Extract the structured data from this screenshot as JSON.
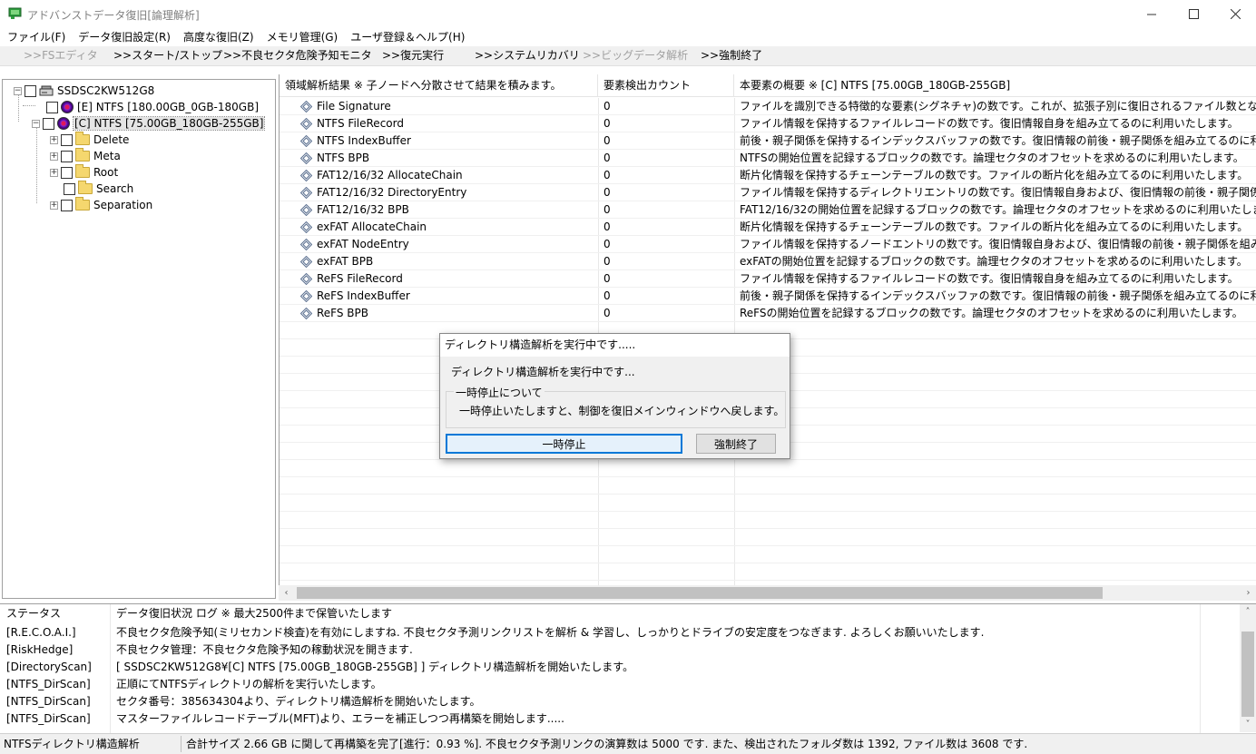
{
  "window": {
    "title": "アドバンストデータ復旧[論理解析]",
    "minimize": "—",
    "maximize": "☐",
    "close": "✕"
  },
  "menu": [
    "ファイル(F)",
    "データ復旧設定(R)",
    "高度な復旧(Z)",
    "メモリ管理(G)",
    "ユーザ登録＆ヘルプ(H)"
  ],
  "toolbar": [
    {
      "label": ">>FSエディタ",
      "enabled": false
    },
    {
      "label": ">>スタート/ストップ",
      "enabled": true
    },
    {
      "label": ">>不良セクタ危険予知モニタ",
      "enabled": true
    },
    {
      "label": ">>復元実行",
      "enabled": true
    },
    {
      "label": ">>システムリカバリ",
      "enabled": true
    },
    {
      "label": ">>ビッグデータ解析",
      "enabled": false
    },
    {
      "label": ">>強制終了",
      "enabled": true
    }
  ],
  "tree": {
    "disk": "SSDSC2KW512G8",
    "volumes": [
      {
        "label": "[E] NTFS [180.00GB_0GB-180GB]"
      },
      {
        "label": "[C] NTFS [75.00GB_180GB-255GB]"
      }
    ],
    "folders": [
      "Delete",
      "Meta",
      "Root",
      "Search",
      "Separation"
    ]
  },
  "list": {
    "headers": {
      "name": "領域解析結果 ※ 子ノードへ分散させて結果を積みます。",
      "count": "要素検出カウント",
      "desc": "本要素の概要 ※ [C] NTFS [75.00GB_180GB-255GB]"
    },
    "rows": [
      {
        "name": "File Signature",
        "count": "0",
        "desc": "ファイルを識別できる特徴的な要素(シグネチャ)の数です。これが、拡張子別に復旧されるファイル数となります。"
      },
      {
        "name": "NTFS FileRecord",
        "count": "0",
        "desc": "ファイル情報を保持するファイルレコードの数です。復旧情報自身を組み立てるのに利用いたします。"
      },
      {
        "name": "NTFS IndexBuffer",
        "count": "0",
        "desc": "前後・親子関係を保持するインデックスバッファの数です。復旧情報の前後・親子関係を組み立てるのに利用いたします。"
      },
      {
        "name": "NTFS BPB",
        "count": "0",
        "desc": "NTFSの開始位置を記録するブロックの数です。論理セクタのオフセットを求めるのに利用いたします。"
      },
      {
        "name": "FAT12/16/32 AllocateChain",
        "count": "0",
        "desc": "断片化情報を保持するチェーンテーブルの数です。ファイルの断片化を組み立てるのに利用いたします。"
      },
      {
        "name": "FAT12/16/32 DirectoryEntry",
        "count": "0",
        "desc": "ファイル情報を保持するディレクトリエントリの数です。復旧情報自身および、復旧情報の前後・親子関係を組み立てるのに"
      },
      {
        "name": "FAT12/16/32 BPB",
        "count": "0",
        "desc": "FAT12/16/32の開始位置を記録するブロックの数です。論理セクタのオフセットを求めるのに利用いたします。"
      },
      {
        "name": "exFAT AllocateChain",
        "count": "0",
        "desc": "断片化情報を保持するチェーンテーブルの数です。ファイルの断片化を組み立てるのに利用いたします。"
      },
      {
        "name": "exFAT NodeEntry",
        "count": "0",
        "desc": "ファイル情報を保持するノードエントリの数です。復旧情報自身および、復旧情報の前後・親子関係を組み立てるのに利用"
      },
      {
        "name": "exFAT BPB",
        "count": "0",
        "desc": "exFATの開始位置を記録するブロックの数です。論理セクタのオフセットを求めるのに利用いたします。"
      },
      {
        "name": "ReFS FileRecord",
        "count": "0",
        "desc": "ファイル情報を保持するファイルレコードの数です。復旧情報自身を組み立てるのに利用いたします。"
      },
      {
        "name": "ReFS IndexBuffer",
        "count": "0",
        "desc": "前後・親子関係を保持するインデックスバッファの数です。復旧情報の前後・親子関係を組み立てるのに利用いたします。"
      },
      {
        "name": "ReFS BPB",
        "count": "0",
        "desc": "ReFSの開始位置を記録するブロックの数です。論理セクタのオフセットを求めるのに利用いたします。"
      }
    ]
  },
  "dialog": {
    "title": "ディレクトリ構造解析を実行中です.....",
    "message": "ディレクトリ構造解析を実行中です...",
    "group_caption": "一時停止について",
    "group_text": "一時停止いたしますと、制御を復旧メインウィンドウへ戻します。",
    "pause_button": "一時停止",
    "force_button": "強制終了"
  },
  "log": {
    "header": {
      "status": "ステータス",
      "message": "データ復旧状況 ログ ※ 最大2500件まで保管いたします"
    },
    "rows": [
      {
        "status": "[R.E.C.O.A.I.]",
        "message": "不良セクタ危険予知(ミリセカンド検査)を有効にしますね. 不良セクタ予測リンクリストを解析 & 学習し、しっかりとドライブの安定度をつなぎます. よろしくお願いいたします."
      },
      {
        "status": "[RiskHedge]",
        "message": "不良セクタ管理：不良セクタ危険予知の稼動状況を開きます."
      },
      {
        "status": "[DirectoryScan]",
        "message": "[ SSDSC2KW512G8¥[C] NTFS [75.00GB_180GB-255GB] ] ディレクトリ構造解析を開始いたします。"
      },
      {
        "status": "[NTFS_DirScan]",
        "message": "正順にてNTFSディレクトリの解析を実行いたします。"
      },
      {
        "status": "[NTFS_DirScan]",
        "message": "セクタ番号：385634304より、ディレクトリ構造解析を開始いたします。"
      },
      {
        "status": "[NTFS_DirScan]",
        "message": "マスターファイルレコードテーブル(MFT)より、エラーを補正しつつ再構築を開始します....."
      }
    ]
  },
  "status": {
    "left": "NTFSディレクトリ構造解析",
    "right": "合計サイズ 2.66 GB に関して再構築を完了[進行：0.93 %]. 不良セクタ予測リンクの演算数は 5000 です. また、検出されたフォルダ数は 1392, ファイル数は 3608 です."
  }
}
